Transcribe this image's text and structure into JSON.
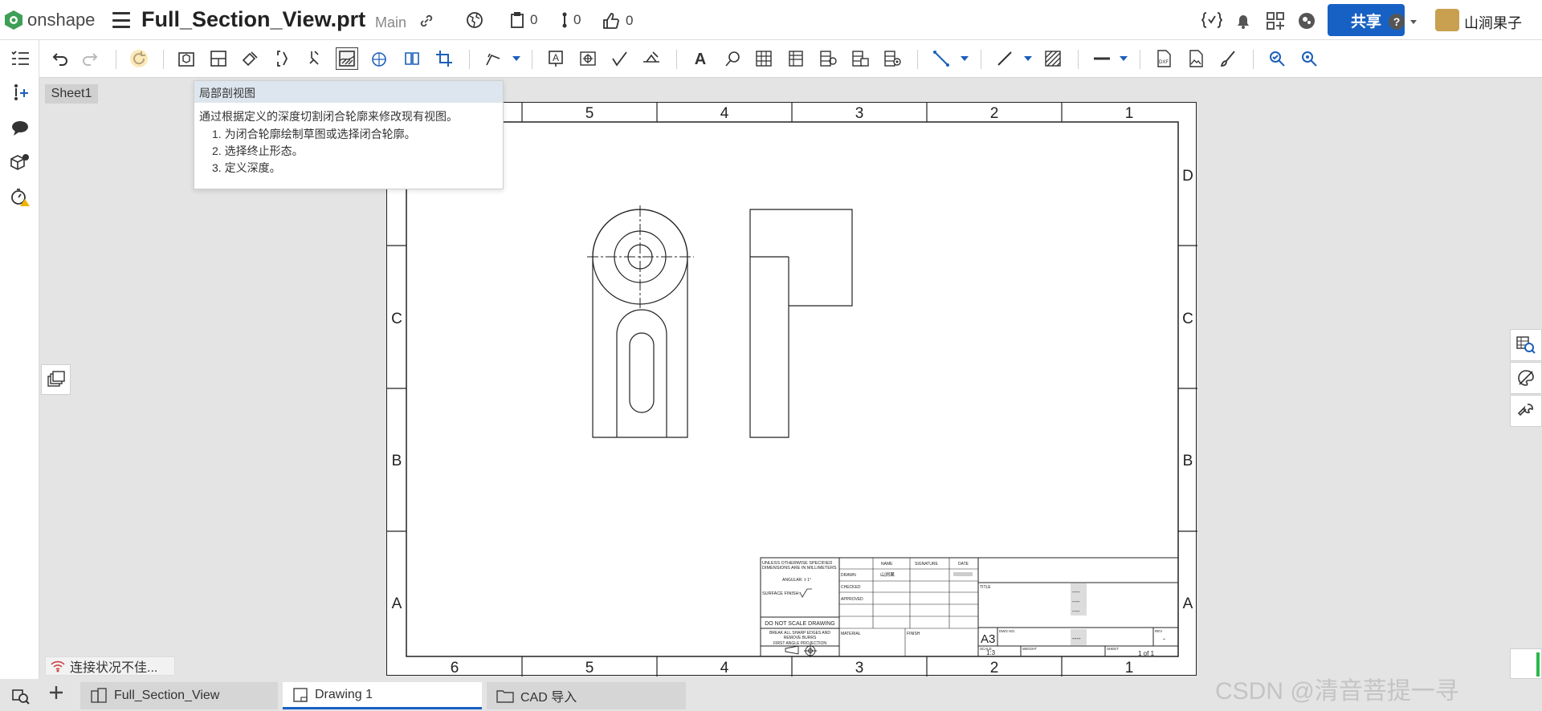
{
  "header": {
    "brand": "onshape",
    "document_title": "Full_Section_View.prt",
    "branch": "Main",
    "counters": {
      "versions": "0",
      "branches": "0",
      "likes": "0"
    },
    "share_label": "共享",
    "user_name": "山涧果子"
  },
  "sheet_tab": "Sheet1",
  "tooltip": {
    "title": "局部剖视图",
    "description": "通过根据定义的深度切割闭合轮廓来修改现有视图。",
    "steps": [
      "1. 为闭合轮廓绘制草图或选择闭合轮廓。",
      "2. 选择终止形态。",
      "3. 定义深度。"
    ]
  },
  "border": {
    "columns_top": [
      "5",
      "4",
      "3",
      "2",
      "1"
    ],
    "columns_bottom": [
      "6",
      "5",
      "4",
      "3",
      "2",
      "1"
    ],
    "rows": [
      "D",
      "C",
      "B",
      "A"
    ]
  },
  "title_block": {
    "tolerance_note": "UNLESS OTHERWISE SPECIFIED\nDIMENSIONS ARE IN MILLIMETERS",
    "angular": "ANGULAR: ± 1°",
    "surface_finish": "SURFACE FINISH:",
    "do_not_scale": "DO NOT SCALE DRAWING",
    "break_edges": "BREAK ALL SHARP EDGES AND\nREMOVE BURRS",
    "projection": "FIRST ANGLE PROJECTION",
    "headers": [
      "NAME",
      "SIGNATURE",
      "DATE"
    ],
    "rows": [
      "DRAWN",
      "CHECKED",
      "APPROVED"
    ],
    "drawn_by": "山涧果",
    "material": "MATERIAL",
    "finish": "FINISH",
    "title_label": "TITLE",
    "size": "A3",
    "dwg_no_label": "DWG NO.",
    "rev_label": "REV",
    "placeholder": "----",
    "rev_value": "-",
    "scale_label": "SCALE",
    "scale": "1:3",
    "weight_label": "WEIGHT",
    "sheet_label": "SHEET",
    "sheet_count": "1 of 1"
  },
  "status": "连接状况不佳...",
  "tabs": [
    "Full_Section_View",
    "Drawing 1",
    "CAD 导入"
  ],
  "watermark": "CSDN @清音菩提一寻"
}
